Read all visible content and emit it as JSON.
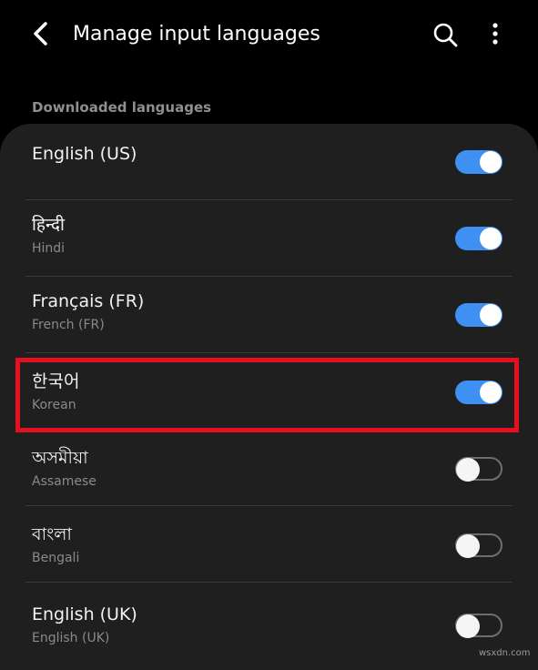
{
  "app_bar": {
    "title": "Manage input languages",
    "back_icon": "back-arrow-icon",
    "search_icon": "search-icon",
    "more_icon": "more-vertical-icon"
  },
  "section": {
    "header": "Downloaded languages"
  },
  "languages": [
    {
      "name": "English (US)",
      "subtitle": "",
      "enabled": true
    },
    {
      "name": "हिन्दी",
      "subtitle": "Hindi",
      "enabled": true
    },
    {
      "name": "Français (FR)",
      "subtitle": "French (FR)",
      "enabled": true
    },
    {
      "name": "한국어",
      "subtitle": "Korean",
      "enabled": true
    },
    {
      "name": "অসমীয়া",
      "subtitle": "Assamese",
      "enabled": false
    },
    {
      "name": "বাংলা",
      "subtitle": "Bengali",
      "enabled": false
    },
    {
      "name": "English (UK)",
      "subtitle": "English (UK)",
      "enabled": false
    }
  ],
  "colors": {
    "toggle_on": "#3e91f2",
    "highlight": "#e3101f",
    "card_bg": "#1f1f1f"
  },
  "watermark": "wsxdn.com"
}
